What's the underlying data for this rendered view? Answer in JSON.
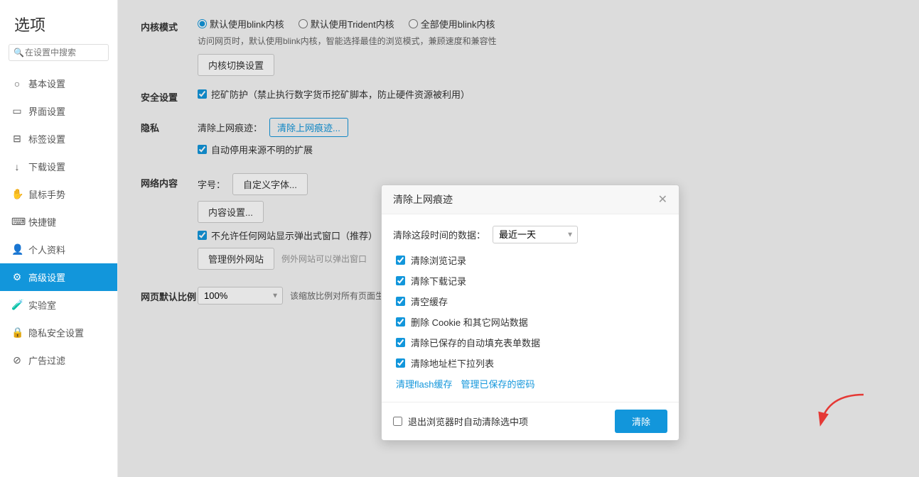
{
  "sidebar": {
    "title": "选项",
    "search_placeholder": "在设置中搜索",
    "items": [
      {
        "id": "basic",
        "label": "基本设置",
        "icon": "⊙"
      },
      {
        "id": "interface",
        "label": "界面设置",
        "icon": "▭"
      },
      {
        "id": "tabs",
        "label": "标签设置",
        "icon": "⊟"
      },
      {
        "id": "download",
        "label": "下载设置",
        "icon": "↓"
      },
      {
        "id": "mouse",
        "label": "鼠标手势",
        "icon": "⊕"
      },
      {
        "id": "shortcut",
        "label": "快捷键",
        "icon": "⊡"
      },
      {
        "id": "profile",
        "label": "个人资料",
        "icon": "👤"
      },
      {
        "id": "advanced",
        "label": "高级设置",
        "icon": "⚙",
        "active": true
      },
      {
        "id": "lab",
        "label": "实验室",
        "icon": "⚗"
      },
      {
        "id": "privacy",
        "label": "隐私安全设置",
        "icon": "🔒"
      },
      {
        "id": "adblock",
        "label": "广告过滤",
        "icon": "⊘"
      }
    ]
  },
  "sections": {
    "kernel_mode": {
      "label": "内核模式",
      "radios": [
        {
          "id": "r1",
          "label": "默认使用blink内核",
          "checked": true
        },
        {
          "id": "r2",
          "label": "默认使用Trident内核",
          "checked": false
        },
        {
          "id": "r3",
          "label": "全部使用blink内核",
          "checked": false
        }
      ],
      "hint": "访问网页时，默认使用blink内核，智能选择最佳的浏览模式，兼顾速度和兼容性",
      "button": "内核切换设置"
    },
    "security": {
      "label": "安全设置",
      "checkbox_label": "挖矿防护（禁止执行数字货币挖矿脚本，防止硬件资源被利用）"
    },
    "privacy": {
      "label": "隐私",
      "clear_label": "清除上网痕迹：",
      "clear_button": "清除上网痕迹...",
      "auto_disable_label": "自动停用来源不明的扩展"
    },
    "network": {
      "label": "网络内容",
      "font_label": "字号：",
      "font_button": "自定义字体...",
      "content_button": "内容设置...",
      "popup_label": "不允许任何网站显示弹出式窗口（推荐）",
      "manage_button": "管理例外网站",
      "manage_hint": "例外网站可以弹出窗口"
    },
    "zoom": {
      "label": "网页默认比例",
      "value": "100%",
      "hint": "该缩放比例对所有页面生效"
    }
  },
  "modal": {
    "title": "清除上网痕迹",
    "close_icon": "✕",
    "time_label": "清除这段时间的数据：",
    "time_option": "最近一天",
    "checkboxes": [
      {
        "label": "清除浏览记录",
        "checked": true
      },
      {
        "label": "清除下载记录",
        "checked": true
      },
      {
        "label": "清空缓存",
        "checked": true
      },
      {
        "label": "删除 Cookie 和其它网站数据",
        "checked": true
      },
      {
        "label": "清除已保存的自动填充表单数据",
        "checked": true
      },
      {
        "label": "清除地址栏下拉列表",
        "checked": true
      }
    ],
    "links": [
      {
        "label": "清理flash缓存"
      },
      {
        "label": "管理已保存的密码"
      }
    ],
    "footer_checkbox": "退出浏览器时自动清除选中项",
    "clear_button": "清除"
  }
}
